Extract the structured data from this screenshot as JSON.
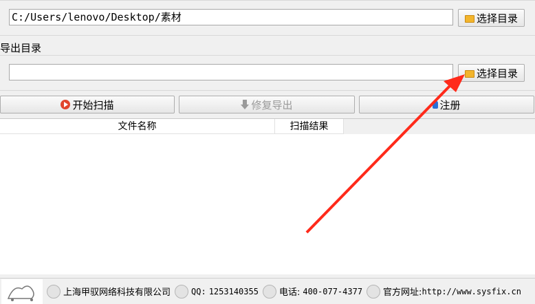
{
  "import": {
    "path_value": "C:/Users/lenovo/Desktop/素材",
    "browse_label": "选择目录"
  },
  "export": {
    "section_label": "导出目录",
    "path_value": "",
    "browse_label": "选择目录"
  },
  "actions": {
    "start_scan": "开始扫描",
    "repair_export": "修复导出",
    "register": "注册"
  },
  "table": {
    "columns": [
      "文件名称",
      "扫描结果"
    ],
    "rows": []
  },
  "footer": {
    "company": "上海甲驭网络科技有限公司",
    "qq_label": "QQ:",
    "qq_value": "1253140355",
    "phone_label": "电话:",
    "phone_value": "400-077-4377",
    "site_label": "官方网址:",
    "site_value": "http://www.sysfix.cn"
  },
  "colors": {
    "arrow": "#ff2a1a",
    "accent_play": "#e1452c",
    "folder": "#f3b52c"
  }
}
